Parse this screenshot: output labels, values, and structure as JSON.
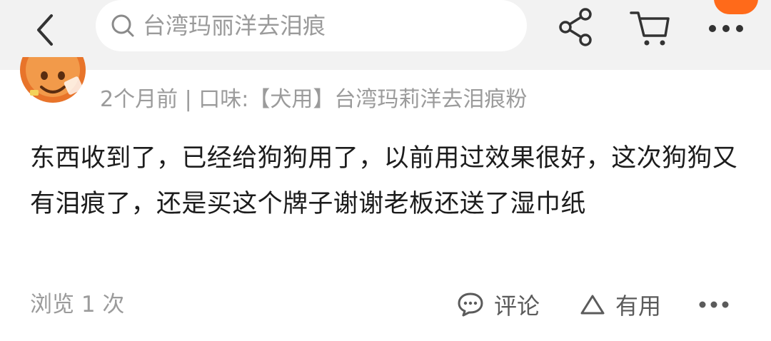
{
  "search": {
    "query": "台湾玛丽洋去泪痕"
  },
  "icons": {
    "back": "chevron-left-icon",
    "search": "search-icon",
    "share": "share-icon",
    "cart": "shopping-cart-icon",
    "more": "more-dots-icon",
    "comment": "comment-bubble-icon",
    "useful": "triangle-up-icon"
  },
  "colors": {
    "accent": "#ff6a1a",
    "topbar_bg": "#f2f2f2",
    "text_primary": "#1c1c1c",
    "text_secondary": "#9b9b9b"
  },
  "review": {
    "meta": "2个月前 | 口味:【犬用】台湾玛莉洋去泪痕粉",
    "body": "东西收到了，已经给狗狗用了，以前用过效果很好，这次狗狗又有泪痕了，还是买这个牌子谢谢老板还送了湿巾纸",
    "views": "浏览 1 次",
    "comment_label": "评论",
    "useful_label": "有用"
  }
}
